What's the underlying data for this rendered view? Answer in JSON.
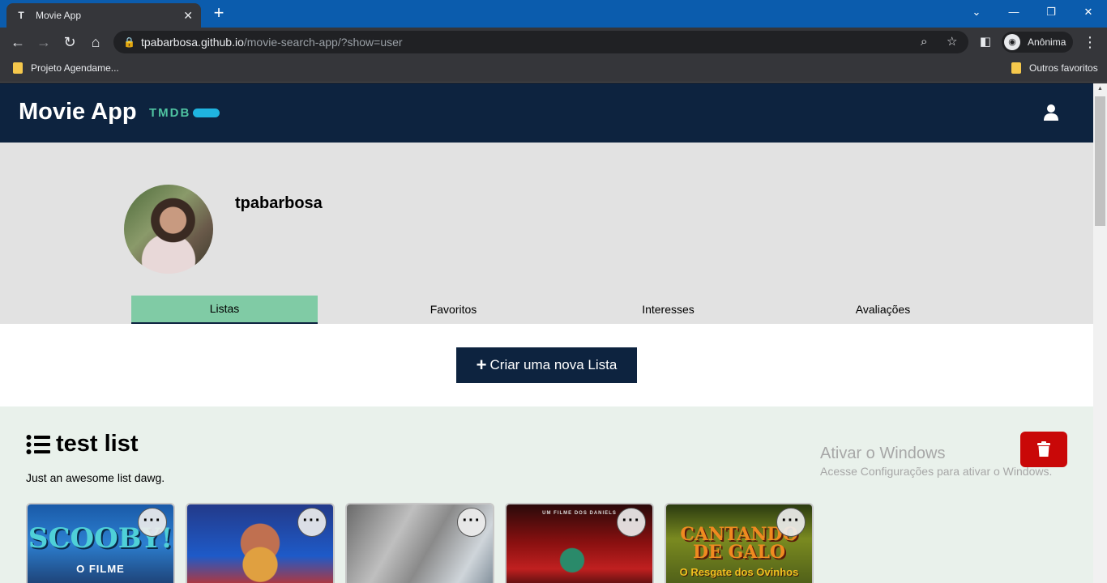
{
  "browser": {
    "tab_favicon": "T",
    "tab_title": "Movie App",
    "tab_close": "✕",
    "new_tab": "+",
    "url_host": "tpabarbosa.github.io",
    "url_path": "/movie-search-app/?show=user",
    "profile_label": "Anônima",
    "bookmarks": [
      "Projeto Agendame...",
      "Outros favoritos"
    ]
  },
  "header": {
    "brand": "Movie App",
    "tmdb_label": "TMDB"
  },
  "profile": {
    "username": "tpabarbosa",
    "tabs": [
      {
        "label": "Listas",
        "active": true
      },
      {
        "label": "Favoritos",
        "active": false
      },
      {
        "label": "Interesses",
        "active": false
      },
      {
        "label": "Avaliações",
        "active": false
      }
    ]
  },
  "create_list": {
    "label": "Criar uma nova Lista"
  },
  "list": {
    "title": "test list",
    "description": "Just an awesome list dawg.",
    "posters": [
      {
        "caption": "SCOOBY!",
        "sub": "O FILME",
        "menu": "···"
      },
      {
        "caption": "",
        "sub": "",
        "menu": "···"
      },
      {
        "caption": "",
        "sub": "",
        "menu": "···"
      },
      {
        "caption": "UM FILME DOS DANIELS",
        "sub": "",
        "menu": "···"
      },
      {
        "caption": "CANTANDO DE GALO",
        "sub": "O Resgate dos Ovinhos",
        "menu": "···"
      }
    ]
  },
  "watermark": {
    "title": "Ativar o Windows",
    "subtitle": "Acesse Configurações para ativar o Windows."
  },
  "colors": {
    "header_bg": "#0d233f",
    "active_tab": "#80cba5",
    "delete": "#c90808",
    "list_bg": "#e9f1eb"
  }
}
